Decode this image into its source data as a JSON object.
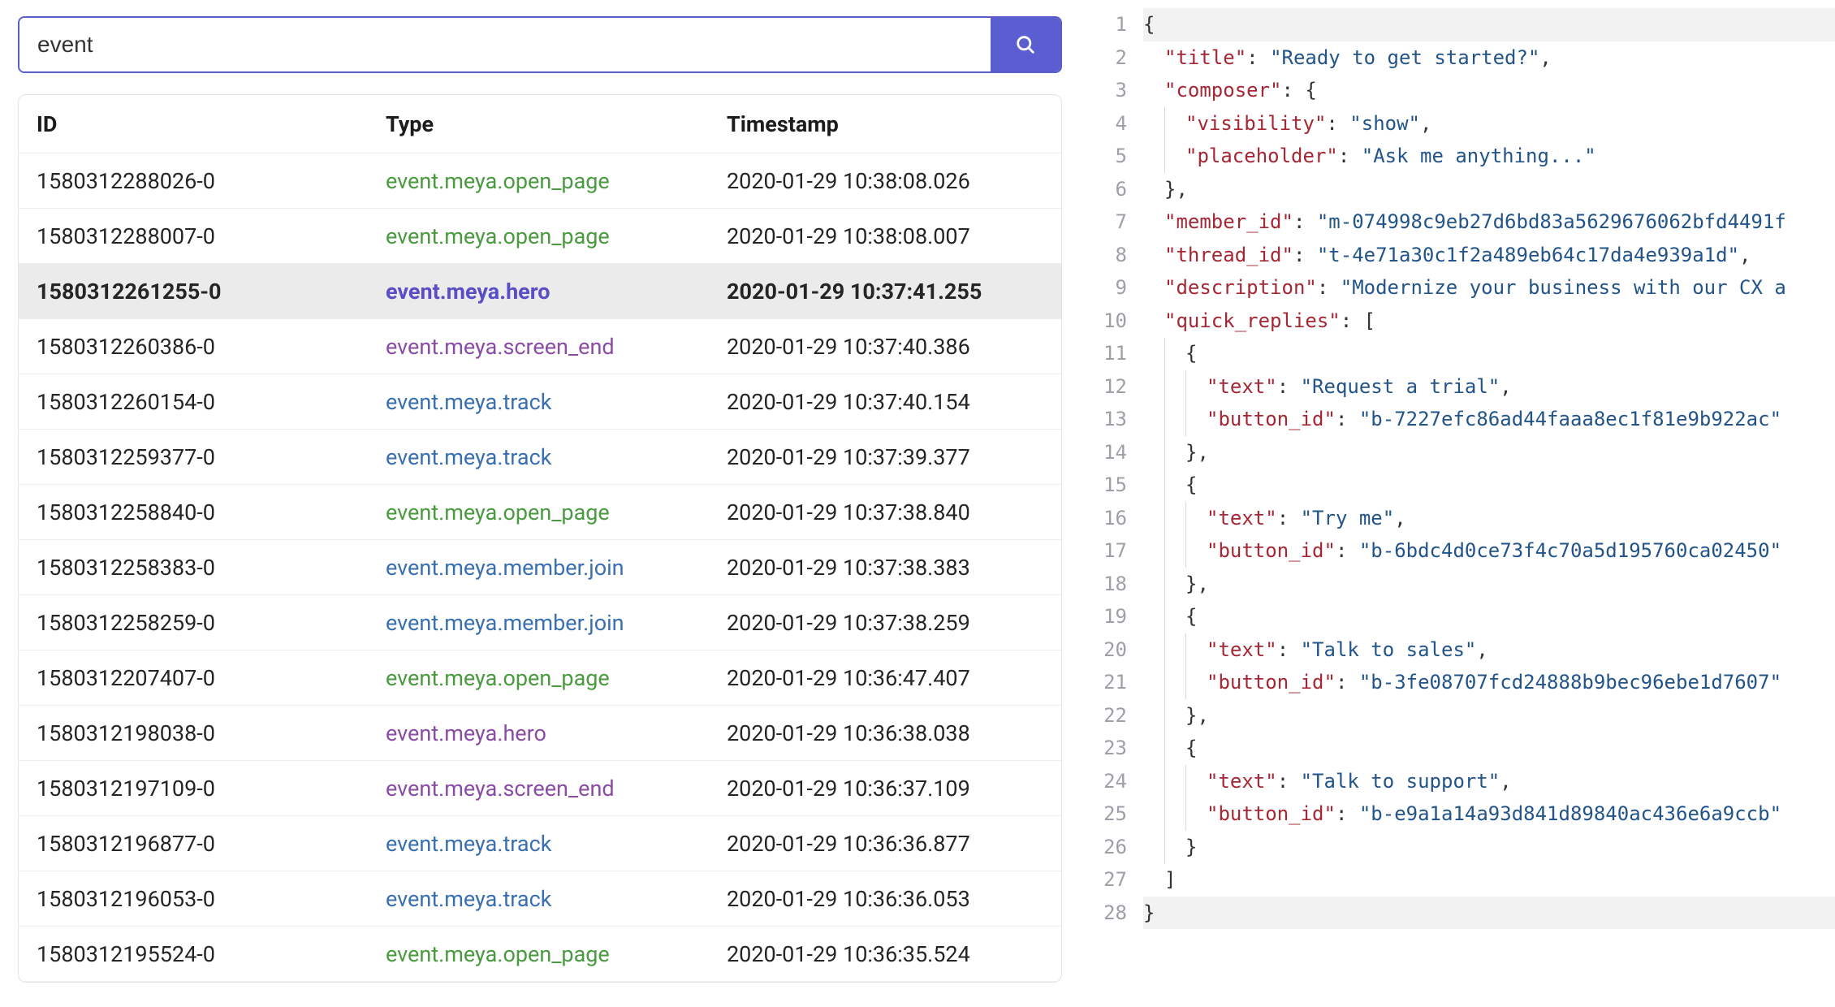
{
  "search": {
    "value": "event"
  },
  "table": {
    "headers": {
      "id": "ID",
      "type": "Type",
      "timestamp": "Timestamp"
    },
    "selected_index": 2,
    "rows": [
      {
        "id": "1580312288026-0",
        "type": "event.meya.open_page",
        "type_color": "green",
        "timestamp": "2020-01-29 10:38:08.026"
      },
      {
        "id": "1580312288007-0",
        "type": "event.meya.open_page",
        "type_color": "green",
        "timestamp": "2020-01-29 10:38:08.007"
      },
      {
        "id": "1580312261255-0",
        "type": "event.meya.hero",
        "type_color": "indigo",
        "timestamp": "2020-01-29 10:37:41.255"
      },
      {
        "id": "1580312260386-0",
        "type": "event.meya.screen_end",
        "type_color": "purple",
        "timestamp": "2020-01-29 10:37:40.386"
      },
      {
        "id": "1580312260154-0",
        "type": "event.meya.track",
        "type_color": "blue",
        "timestamp": "2020-01-29 10:37:40.154"
      },
      {
        "id": "1580312259377-0",
        "type": "event.meya.track",
        "type_color": "blue",
        "timestamp": "2020-01-29 10:37:39.377"
      },
      {
        "id": "1580312258840-0",
        "type": "event.meya.open_page",
        "type_color": "green",
        "timestamp": "2020-01-29 10:37:38.840"
      },
      {
        "id": "1580312258383-0",
        "type": "event.meya.member.join",
        "type_color": "blue",
        "timestamp": "2020-01-29 10:37:38.383"
      },
      {
        "id": "1580312258259-0",
        "type": "event.meya.member.join",
        "type_color": "blue",
        "timestamp": "2020-01-29 10:37:38.259"
      },
      {
        "id": "1580312207407-0",
        "type": "event.meya.open_page",
        "type_color": "green",
        "timestamp": "2020-01-29 10:36:47.407"
      },
      {
        "id": "1580312198038-0",
        "type": "event.meya.hero",
        "type_color": "purple",
        "timestamp": "2020-01-29 10:36:38.038"
      },
      {
        "id": "1580312197109-0",
        "type": "event.meya.screen_end",
        "type_color": "purple",
        "timestamp": "2020-01-29 10:36:37.109"
      },
      {
        "id": "1580312196877-0",
        "type": "event.meya.track",
        "type_color": "blue",
        "timestamp": "2020-01-29 10:36:36.877"
      },
      {
        "id": "1580312196053-0",
        "type": "event.meya.track",
        "type_color": "blue",
        "timestamp": "2020-01-29 10:36:36.053"
      },
      {
        "id": "1580312195524-0",
        "type": "event.meya.open_page",
        "type_color": "green",
        "timestamp": "2020-01-29 10:36:35.524"
      }
    ]
  },
  "json_viewer": {
    "line_count": 28,
    "lines": [
      {
        "indent": 0,
        "tokens": [
          {
            "t": "br",
            "v": "{"
          }
        ],
        "hl": true
      },
      {
        "indent": 1,
        "tokens": [
          {
            "t": "key",
            "v": "\"title\""
          },
          {
            "t": "punc",
            "v": ": "
          },
          {
            "t": "str",
            "v": "\"Ready to get started?\""
          },
          {
            "t": "punc",
            "v": ","
          }
        ]
      },
      {
        "indent": 1,
        "tokens": [
          {
            "t": "key",
            "v": "\"composer\""
          },
          {
            "t": "punc",
            "v": ": "
          },
          {
            "t": "br",
            "v": "{"
          }
        ]
      },
      {
        "indent": 2,
        "tokens": [
          {
            "t": "key",
            "v": "\"visibility\""
          },
          {
            "t": "punc",
            "v": ": "
          },
          {
            "t": "str",
            "v": "\"show\""
          },
          {
            "t": "punc",
            "v": ","
          }
        ]
      },
      {
        "indent": 2,
        "tokens": [
          {
            "t": "key",
            "v": "\"placeholder\""
          },
          {
            "t": "punc",
            "v": ": "
          },
          {
            "t": "str",
            "v": "\"Ask me anything...\""
          }
        ]
      },
      {
        "indent": 1,
        "tokens": [
          {
            "t": "br",
            "v": "}"
          },
          {
            "t": "punc",
            "v": ","
          }
        ]
      },
      {
        "indent": 1,
        "tokens": [
          {
            "t": "key",
            "v": "\"member_id\""
          },
          {
            "t": "punc",
            "v": ": "
          },
          {
            "t": "str",
            "v": "\"m-074998c9eb27d6bd83a5629676062bfd4491f"
          }
        ]
      },
      {
        "indent": 1,
        "tokens": [
          {
            "t": "key",
            "v": "\"thread_id\""
          },
          {
            "t": "punc",
            "v": ": "
          },
          {
            "t": "str",
            "v": "\"t-4e71a30c1f2a489eb64c17da4e939a1d\""
          },
          {
            "t": "punc",
            "v": ","
          }
        ]
      },
      {
        "indent": 1,
        "tokens": [
          {
            "t": "key",
            "v": "\"description\""
          },
          {
            "t": "punc",
            "v": ": "
          },
          {
            "t": "str",
            "v": "\"Modernize your business with our CX a"
          }
        ]
      },
      {
        "indent": 1,
        "tokens": [
          {
            "t": "key",
            "v": "\"quick_replies\""
          },
          {
            "t": "punc",
            "v": ": "
          },
          {
            "t": "br",
            "v": "["
          }
        ]
      },
      {
        "indent": 2,
        "tokens": [
          {
            "t": "br",
            "v": "{"
          }
        ]
      },
      {
        "indent": 3,
        "tokens": [
          {
            "t": "key",
            "v": "\"text\""
          },
          {
            "t": "punc",
            "v": ": "
          },
          {
            "t": "str",
            "v": "\"Request a trial\""
          },
          {
            "t": "punc",
            "v": ","
          }
        ]
      },
      {
        "indent": 3,
        "tokens": [
          {
            "t": "key",
            "v": "\"button_id\""
          },
          {
            "t": "punc",
            "v": ": "
          },
          {
            "t": "str",
            "v": "\"b-7227efc86ad44faaa8ec1f81e9b922ac\""
          }
        ]
      },
      {
        "indent": 2,
        "tokens": [
          {
            "t": "br",
            "v": "}"
          },
          {
            "t": "punc",
            "v": ","
          }
        ]
      },
      {
        "indent": 2,
        "tokens": [
          {
            "t": "br",
            "v": "{"
          }
        ]
      },
      {
        "indent": 3,
        "tokens": [
          {
            "t": "key",
            "v": "\"text\""
          },
          {
            "t": "punc",
            "v": ": "
          },
          {
            "t": "str",
            "v": "\"Try me\""
          },
          {
            "t": "punc",
            "v": ","
          }
        ]
      },
      {
        "indent": 3,
        "tokens": [
          {
            "t": "key",
            "v": "\"button_id\""
          },
          {
            "t": "punc",
            "v": ": "
          },
          {
            "t": "str",
            "v": "\"b-6bdc4d0ce73f4c70a5d195760ca02450\""
          }
        ]
      },
      {
        "indent": 2,
        "tokens": [
          {
            "t": "br",
            "v": "}"
          },
          {
            "t": "punc",
            "v": ","
          }
        ]
      },
      {
        "indent": 2,
        "tokens": [
          {
            "t": "br",
            "v": "{"
          }
        ]
      },
      {
        "indent": 3,
        "tokens": [
          {
            "t": "key",
            "v": "\"text\""
          },
          {
            "t": "punc",
            "v": ": "
          },
          {
            "t": "str",
            "v": "\"Talk to sales\""
          },
          {
            "t": "punc",
            "v": ","
          }
        ]
      },
      {
        "indent": 3,
        "tokens": [
          {
            "t": "key",
            "v": "\"button_id\""
          },
          {
            "t": "punc",
            "v": ": "
          },
          {
            "t": "str",
            "v": "\"b-3fe08707fcd24888b9bec96ebe1d7607\""
          }
        ]
      },
      {
        "indent": 2,
        "tokens": [
          {
            "t": "br",
            "v": "}"
          },
          {
            "t": "punc",
            "v": ","
          }
        ]
      },
      {
        "indent": 2,
        "tokens": [
          {
            "t": "br",
            "v": "{"
          }
        ]
      },
      {
        "indent": 3,
        "tokens": [
          {
            "t": "key",
            "v": "\"text\""
          },
          {
            "t": "punc",
            "v": ": "
          },
          {
            "t": "str",
            "v": "\"Talk to support\""
          },
          {
            "t": "punc",
            "v": ","
          }
        ]
      },
      {
        "indent": 3,
        "tokens": [
          {
            "t": "key",
            "v": "\"button_id\""
          },
          {
            "t": "punc",
            "v": ": "
          },
          {
            "t": "str",
            "v": "\"b-e9a1a14a93d841d89840ac436e6a9ccb\""
          }
        ]
      },
      {
        "indent": 2,
        "tokens": [
          {
            "t": "br",
            "v": "}"
          }
        ]
      },
      {
        "indent": 1,
        "tokens": [
          {
            "t": "br",
            "v": "]"
          }
        ]
      },
      {
        "indent": 0,
        "tokens": [
          {
            "t": "br",
            "v": "}"
          }
        ],
        "hl": true
      }
    ]
  }
}
